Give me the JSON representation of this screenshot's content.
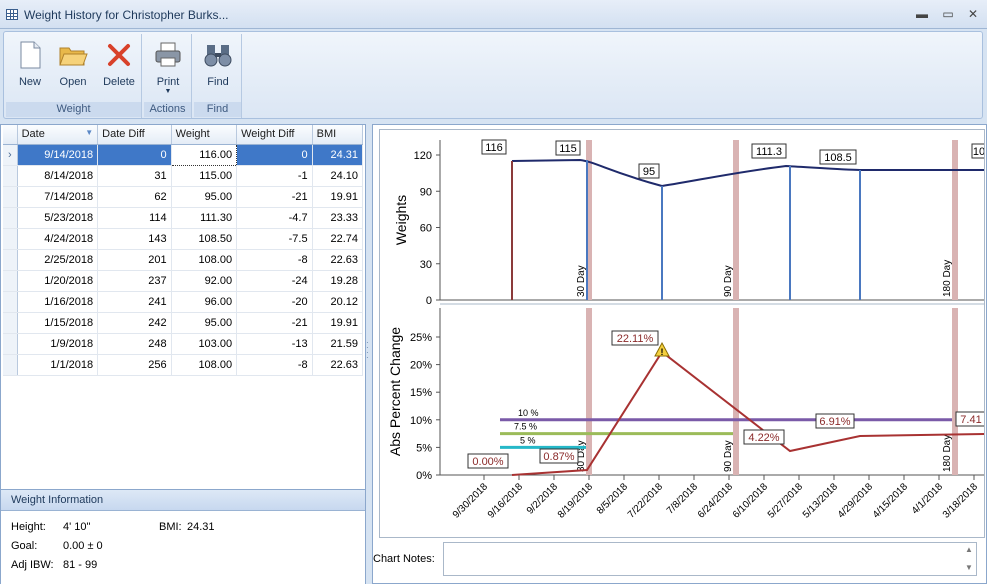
{
  "window": {
    "title": "Weight History for Christopher Burks...",
    "min": "▬",
    "max": "▭",
    "close": "✕"
  },
  "ribbon": {
    "groups": [
      {
        "label": "Weight",
        "buttons": [
          {
            "label": "New",
            "icon": "new-document-icon"
          },
          {
            "label": "Open",
            "icon": "open-folder-icon"
          },
          {
            "label": "Delete",
            "icon": "delete-x-icon"
          }
        ]
      },
      {
        "label": "Actions",
        "buttons": [
          {
            "label": "Print",
            "icon": "printer-icon"
          }
        ]
      },
      {
        "label": "Find",
        "buttons": [
          {
            "label": "Find",
            "icon": "binoculars-icon"
          }
        ]
      }
    ]
  },
  "grid": {
    "columns": [
      "Date",
      "Date Diff",
      "Weight",
      "Weight Diff",
      "BMI"
    ],
    "rows": [
      [
        "9/14/2018",
        "0",
        "116.00",
        "0",
        "24.31"
      ],
      [
        "8/14/2018",
        "31",
        "115.00",
        "-1",
        "24.10"
      ],
      [
        "7/14/2018",
        "62",
        "95.00",
        "-21",
        "19.91"
      ],
      [
        "5/23/2018",
        "114",
        "111.30",
        "-4.7",
        "23.33"
      ],
      [
        "4/24/2018",
        "143",
        "108.50",
        "-7.5",
        "22.74"
      ],
      [
        "2/25/2018",
        "201",
        "108.00",
        "-8",
        "22.63"
      ],
      [
        "1/20/2018",
        "237",
        "92.00",
        "-24",
        "19.28"
      ],
      [
        "1/16/2018",
        "241",
        "96.00",
        "-20",
        "20.12"
      ],
      [
        "1/15/2018",
        "242",
        "95.00",
        "-21",
        "19.91"
      ],
      [
        "1/9/2018",
        "248",
        "103.00",
        "-13",
        "21.59"
      ],
      [
        "1/1/2018",
        "256",
        "108.00",
        "-8",
        "22.63"
      ]
    ]
  },
  "weight_info": {
    "title": "Weight Information",
    "height_label": "Height:",
    "height_value": "4' 10\"",
    "bmi_label": "BMI:",
    "bmi_value": "24.31",
    "goal_label": "Goal:",
    "goal_value": "0.00 ± 0",
    "ibw_label": "Adj IBW:",
    "ibw_value": "81 - 99"
  },
  "notes": {
    "label": "Chart Notes:",
    "value": ""
  },
  "chart_data": [
    {
      "type": "line",
      "ylabel": "Weights",
      "ylim": [
        0,
        130
      ],
      "yticks": [
        "120",
        "90",
        "60",
        "30",
        "0"
      ],
      "point_labels": [
        "116",
        "115",
        "95",
        "111.3",
        "108.5",
        "10"
      ],
      "markers": [
        "30 Day",
        "90 Day",
        "180 Day"
      ]
    },
    {
      "type": "line",
      "ylabel": "Abs Percent Change",
      "ylim": [
        0,
        25
      ],
      "yticks": [
        "25%",
        "20%",
        "15%",
        "10%",
        "5%",
        "0%"
      ],
      "point_labels": [
        "0.00%",
        "0.87%",
        "22.11%",
        "4.22%",
        "6.91%",
        "7.41"
      ],
      "thresholds": [
        {
          "label": "10 %",
          "value": 10,
          "color": "#7a5aa8"
        },
        {
          "label": "7.5 %",
          "value": 7.5,
          "color": "#9bbb59"
        },
        {
          "label": "5 %",
          "value": 5,
          "color": "#26b8c8"
        }
      ],
      "markers": [
        "30 Day",
        "90 Day",
        "180 Day"
      ],
      "xticks": [
        "9/30/2018",
        "9/16/2018",
        "9/2/2018",
        "8/19/2018",
        "8/5/2018",
        "7/22/2018",
        "7/8/2018",
        "6/24/2018",
        "6/10/2018",
        "5/27/2018",
        "5/13/2018",
        "4/29/2018",
        "4/15/2018",
        "4/1/2018",
        "3/18/2018"
      ]
    }
  ]
}
